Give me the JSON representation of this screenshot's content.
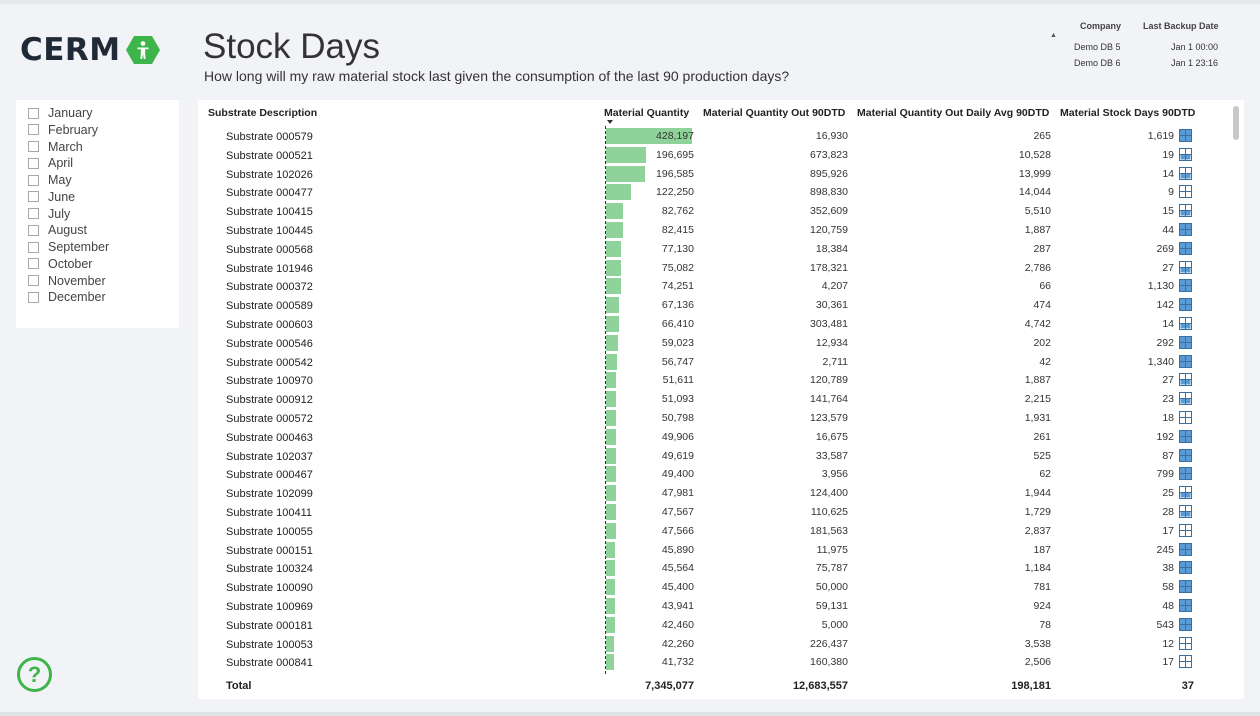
{
  "logo": {
    "text": "CERM"
  },
  "header": {
    "title": "Stock Days",
    "subtitle": "How long will my raw material stock last given the consumption of the last 90 production days?"
  },
  "info": {
    "col_company": "Company",
    "col_backup": "Last Backup Date",
    "rows": [
      {
        "company": "Demo DB 5",
        "date": "Jan 1 00:00"
      },
      {
        "company": "Demo DB 6",
        "date": "Jan 1 23:16"
      }
    ]
  },
  "months": [
    "January",
    "February",
    "March",
    "April",
    "May",
    "June",
    "July",
    "August",
    "September",
    "October",
    "November",
    "December"
  ],
  "table": {
    "headers": {
      "desc": "Substrate Description",
      "mq": "Material Quantity",
      "mo": "Material Quantity Out 90DTD",
      "ma": "Material Quantity Out Daily Avg 90DTD",
      "sd": "Material Stock Days 90DTD"
    },
    "bar_max": 428197,
    "rows": [
      {
        "desc": "Substrate 000579",
        "mq": "428,197",
        "mq_val": 428197,
        "mo": "16,930",
        "ma": "265",
        "sd": "1,619",
        "icon": "blue"
      },
      {
        "desc": "Substrate 000521",
        "mq": "196,695",
        "mq_val": 196695,
        "mo": "673,823",
        "ma": "10,528",
        "sd": "19",
        "icon": "outline"
      },
      {
        "desc": "Substrate 102026",
        "mq": "196,585",
        "mq_val": 196585,
        "mo": "895,926",
        "ma": "13,999",
        "sd": "14",
        "icon": "outline"
      },
      {
        "desc": "Substrate 000477",
        "mq": "122,250",
        "mq_val": 122250,
        "mo": "898,830",
        "ma": "14,044",
        "sd": "9",
        "icon": "white"
      },
      {
        "desc": "Substrate 100415",
        "mq": "82,762",
        "mq_val": 82762,
        "mo": "352,609",
        "ma": "5,510",
        "sd": "15",
        "icon": "outline"
      },
      {
        "desc": "Substrate 100445",
        "mq": "82,415",
        "mq_val": 82415,
        "mo": "120,759",
        "ma": "1,887",
        "sd": "44",
        "icon": "blue"
      },
      {
        "desc": "Substrate 000568",
        "mq": "77,130",
        "mq_val": 77130,
        "mo": "18,384",
        "ma": "287",
        "sd": "269",
        "icon": "blue"
      },
      {
        "desc": "Substrate 101946",
        "mq": "75,082",
        "mq_val": 75082,
        "mo": "178,321",
        "ma": "2,786",
        "sd": "27",
        "icon": "outline"
      },
      {
        "desc": "Substrate 000372",
        "mq": "74,251",
        "mq_val": 74251,
        "mo": "4,207",
        "ma": "66",
        "sd": "1,130",
        "icon": "blue"
      },
      {
        "desc": "Substrate 000589",
        "mq": "67,136",
        "mq_val": 67136,
        "mo": "30,361",
        "ma": "474",
        "sd": "142",
        "icon": "blue"
      },
      {
        "desc": "Substrate 000603",
        "mq": "66,410",
        "mq_val": 66410,
        "mo": "303,481",
        "ma": "4,742",
        "sd": "14",
        "icon": "outline"
      },
      {
        "desc": "Substrate 000546",
        "mq": "59,023",
        "mq_val": 59023,
        "mo": "12,934",
        "ma": "202",
        "sd": "292",
        "icon": "blue"
      },
      {
        "desc": "Substrate 000542",
        "mq": "56,747",
        "mq_val": 56747,
        "mo": "2,711",
        "ma": "42",
        "sd": "1,340",
        "icon": "blue"
      },
      {
        "desc": "Substrate 100970",
        "mq": "51,611",
        "mq_val": 51611,
        "mo": "120,789",
        "ma": "1,887",
        "sd": "27",
        "icon": "outline"
      },
      {
        "desc": "Substrate 000912",
        "mq": "51,093",
        "mq_val": 51093,
        "mo": "141,764",
        "ma": "2,215",
        "sd": "23",
        "icon": "outline"
      },
      {
        "desc": "Substrate 000572",
        "mq": "50,798",
        "mq_val": 50798,
        "mo": "123,579",
        "ma": "1,931",
        "sd": "18",
        "icon": "white"
      },
      {
        "desc": "Substrate 000463",
        "mq": "49,906",
        "mq_val": 49906,
        "mo": "16,675",
        "ma": "261",
        "sd": "192",
        "icon": "blue"
      },
      {
        "desc": "Substrate 102037",
        "mq": "49,619",
        "mq_val": 49619,
        "mo": "33,587",
        "ma": "525",
        "sd": "87",
        "icon": "blue"
      },
      {
        "desc": "Substrate 000467",
        "mq": "49,400",
        "mq_val": 49400,
        "mo": "3,956",
        "ma": "62",
        "sd": "799",
        "icon": "blue"
      },
      {
        "desc": "Substrate 102099",
        "mq": "47,981",
        "mq_val": 47981,
        "mo": "124,400",
        "ma": "1,944",
        "sd": "25",
        "icon": "outline"
      },
      {
        "desc": "Substrate 100411",
        "mq": "47,567",
        "mq_val": 47567,
        "mo": "110,625",
        "ma": "1,729",
        "sd": "28",
        "icon": "outline"
      },
      {
        "desc": "Substrate 100055",
        "mq": "47,566",
        "mq_val": 47566,
        "mo": "181,563",
        "ma": "2,837",
        "sd": "17",
        "icon": "white"
      },
      {
        "desc": "Substrate 000151",
        "mq": "45,890",
        "mq_val": 45890,
        "mo": "11,975",
        "ma": "187",
        "sd": "245",
        "icon": "blue"
      },
      {
        "desc": "Substrate 100324",
        "mq": "45,564",
        "mq_val": 45564,
        "mo": "75,787",
        "ma": "1,184",
        "sd": "38",
        "icon": "blue"
      },
      {
        "desc": "Substrate 100090",
        "mq": "45,400",
        "mq_val": 45400,
        "mo": "50,000",
        "ma": "781",
        "sd": "58",
        "icon": "blue"
      },
      {
        "desc": "Substrate 100969",
        "mq": "43,941",
        "mq_val": 43941,
        "mo": "59,131",
        "ma": "924",
        "sd": "48",
        "icon": "blue"
      },
      {
        "desc": "Substrate 000181",
        "mq": "42,460",
        "mq_val": 42460,
        "mo": "5,000",
        "ma": "78",
        "sd": "543",
        "icon": "blue"
      },
      {
        "desc": "Substrate 100053",
        "mq": "42,260",
        "mq_val": 42260,
        "mo": "226,437",
        "ma": "3,538",
        "sd": "12",
        "icon": "white"
      },
      {
        "desc": "Substrate 000841",
        "mq": "41,732",
        "mq_val": 41732,
        "mo": "160,380",
        "ma": "2,506",
        "sd": "17",
        "icon": "white"
      }
    ],
    "total": {
      "label": "Total",
      "mq": "7,345,077",
      "mo": "12,683,557",
      "ma": "198,181",
      "sd": "37"
    }
  },
  "colors": {
    "bar": "#8fd39a",
    "accent_green": "#3eb54a",
    "icon_blue": "#5b9bd5"
  },
  "help": {
    "glyph": "?"
  }
}
